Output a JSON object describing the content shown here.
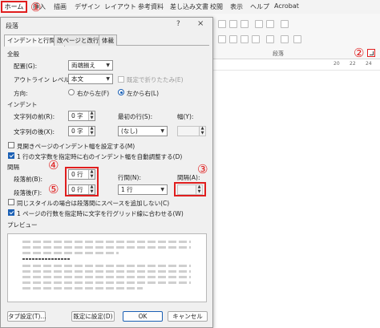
{
  "ribbon": {
    "tabs": [
      "ホーム",
      "挿入",
      "描画",
      "デザイン",
      "レイアウト",
      "参考資料",
      "差し込み文書",
      "校閲",
      "表示",
      "ヘルプ",
      "Acrobat"
    ],
    "group_label": "段落",
    "ruler_numbers": [
      "20",
      "22",
      "24"
    ]
  },
  "callouts": [
    "①",
    "②",
    "③",
    "④",
    "⑤"
  ],
  "accent_color": "#e01e1e",
  "dialog": {
    "title": "段落",
    "help": "?",
    "close": "×",
    "tabs": [
      "インデントと行間隔",
      "改ページと改行",
      "体裁"
    ],
    "general": {
      "heading": "全般",
      "alignment_label": "配置(G):",
      "alignment_value": "両端揃え",
      "outline_label": "アウトライン レベル(O):",
      "outline_value": "本文",
      "collapsed_label": "既定で折りたたみ(E)",
      "direction_label": "方向:",
      "rtl_label": "右から左(F)",
      "ltr_label": "左から右(L)"
    },
    "indent": {
      "heading": "インデント",
      "before_label": "文字列の前(R):",
      "before_value": "0 字",
      "after_label": "文字列の後(X):",
      "after_value": "0 字",
      "first_line_label": "最初の行(S):",
      "first_line_value": "(なし)",
      "width_label": "幅(Y):",
      "mirror_label": "見開きページのインデント幅を設定する(M)",
      "auto_adjust_label": "1 行の文字数を指定時に右のインデント幅を自動調整する(D)"
    },
    "spacing": {
      "heading": "間隔",
      "before_label": "段落前(B):",
      "before_value": "0 行",
      "after_label": "段落後(F):",
      "after_value": "0 行",
      "line_label": "行間(N):",
      "line_value": "1 行",
      "at_label": "間隔(A):",
      "at_value": "",
      "no_space_label": "同じスタイルの場合は段落間にスペースを追加しない(C)",
      "grid_label": "1 ページの行数を指定時に文字を行グリッド線に合わせる(W)"
    },
    "preview_label": "プレビュー",
    "buttons": {
      "tabs": "タブ設定(T)...",
      "default": "既定に設定(D)",
      "ok": "OK",
      "cancel": "キャンセル"
    }
  }
}
